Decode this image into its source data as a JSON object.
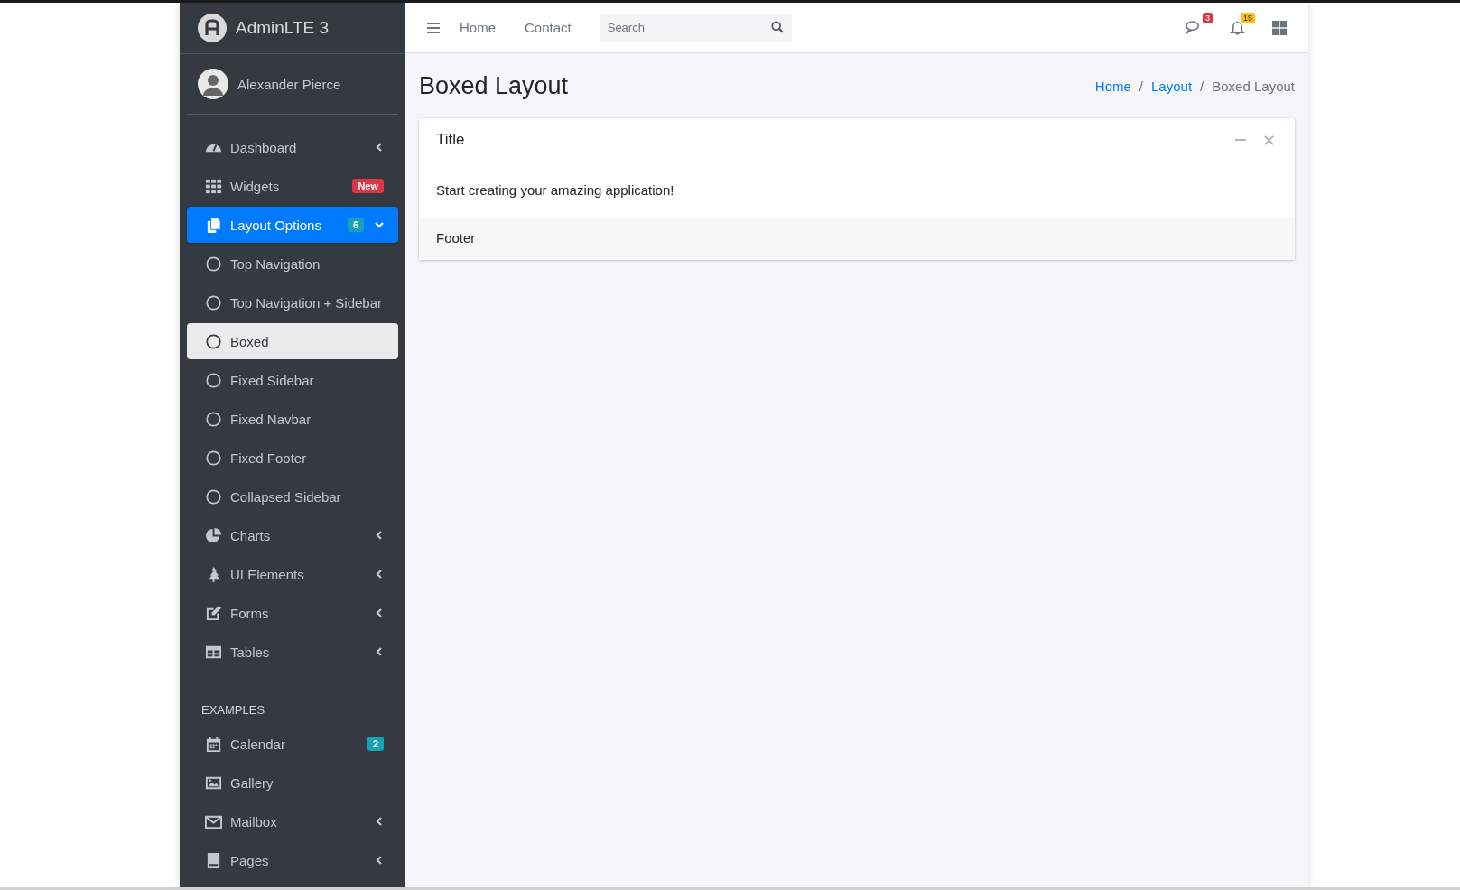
{
  "brand": {
    "name": "AdminLTE 3"
  },
  "user": {
    "name": "Alexander Pierce"
  },
  "sidebar": {
    "items": [
      {
        "kind": "link",
        "label": "Dashboard",
        "selected": false,
        "expanded": false
      },
      {
        "kind": "link",
        "label": "Widgets",
        "selected": false,
        "badge": {
          "text": "New",
          "color": "#dc3545"
        }
      },
      {
        "kind": "link",
        "label": "Layout Options",
        "selected": true,
        "expanded": true,
        "badge": {
          "text": "6",
          "color": "#17a2b8"
        },
        "children": [
          {
            "label": "Top Navigation",
            "selected": false
          },
          {
            "label": "Top Navigation + Sidebar",
            "selected": false
          },
          {
            "label": "Boxed",
            "selected": true
          },
          {
            "label": "Fixed Sidebar",
            "selected": false
          },
          {
            "label": "Fixed Navbar",
            "selected": false
          },
          {
            "label": "Fixed Footer",
            "selected": false
          },
          {
            "label": "Collapsed Sidebar",
            "selected": false
          }
        ]
      },
      {
        "kind": "link",
        "label": "Charts",
        "selected": false,
        "expanded": false
      },
      {
        "kind": "link",
        "label": "UI Elements",
        "selected": false,
        "expanded": false
      },
      {
        "kind": "link",
        "label": "Forms",
        "selected": false,
        "expanded": false
      },
      {
        "kind": "link",
        "label": "Tables",
        "selected": false,
        "expanded": false
      },
      {
        "kind": "header",
        "label": "EXAMPLES"
      },
      {
        "kind": "link",
        "label": "Calendar",
        "selected": false,
        "badge": {
          "text": "2",
          "color": "#17a2b8"
        }
      },
      {
        "kind": "link",
        "label": "Gallery",
        "selected": false
      },
      {
        "kind": "link",
        "label": "Mailbox",
        "selected": false,
        "expanded": false
      },
      {
        "kind": "link",
        "label": "Pages",
        "selected": false,
        "expanded": false
      }
    ]
  },
  "navbar": {
    "links": [
      {
        "label": "Home"
      },
      {
        "label": "Contact"
      }
    ],
    "search": {
      "placeholder": "Search"
    },
    "notifications": [
      {
        "badge": "3",
        "color": "#dc3545"
      },
      {
        "badge": "15",
        "color": "#ffc107"
      }
    ]
  },
  "page": {
    "title": "Boxed Layout",
    "breadcrumb": [
      {
        "label": "Home",
        "selected": false
      },
      {
        "separator": "/",
        "label": "Layout",
        "selected": false
      },
      {
        "separator": "/",
        "label": "Boxed Layout",
        "selected": true
      }
    ]
  },
  "card": {
    "title": "Title",
    "body": "Start creating your amazing application!",
    "footer": "Footer"
  }
}
